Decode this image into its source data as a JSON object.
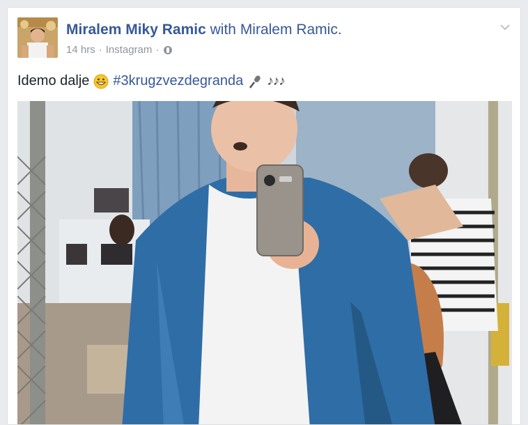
{
  "post": {
    "author": "Miralem Miky Ramic",
    "with_text": "with",
    "tagged": "Miralem Ramic.",
    "time": "14 hrs",
    "separator": "·",
    "source": "Instagram",
    "status_text": "Idemo dalje",
    "hashtag": "#3krugzvezdegranda",
    "notes": "♪♪♪",
    "icons": {
      "emoji": "grinning-face-icon",
      "microphone": "microphone-icon",
      "privacy": "globe-icon",
      "menu": "chevron-down-icon"
    }
  },
  "colors": {
    "link": "#365899",
    "meta": "#90949c",
    "text": "#1d2129",
    "background": "#e9ebee"
  }
}
